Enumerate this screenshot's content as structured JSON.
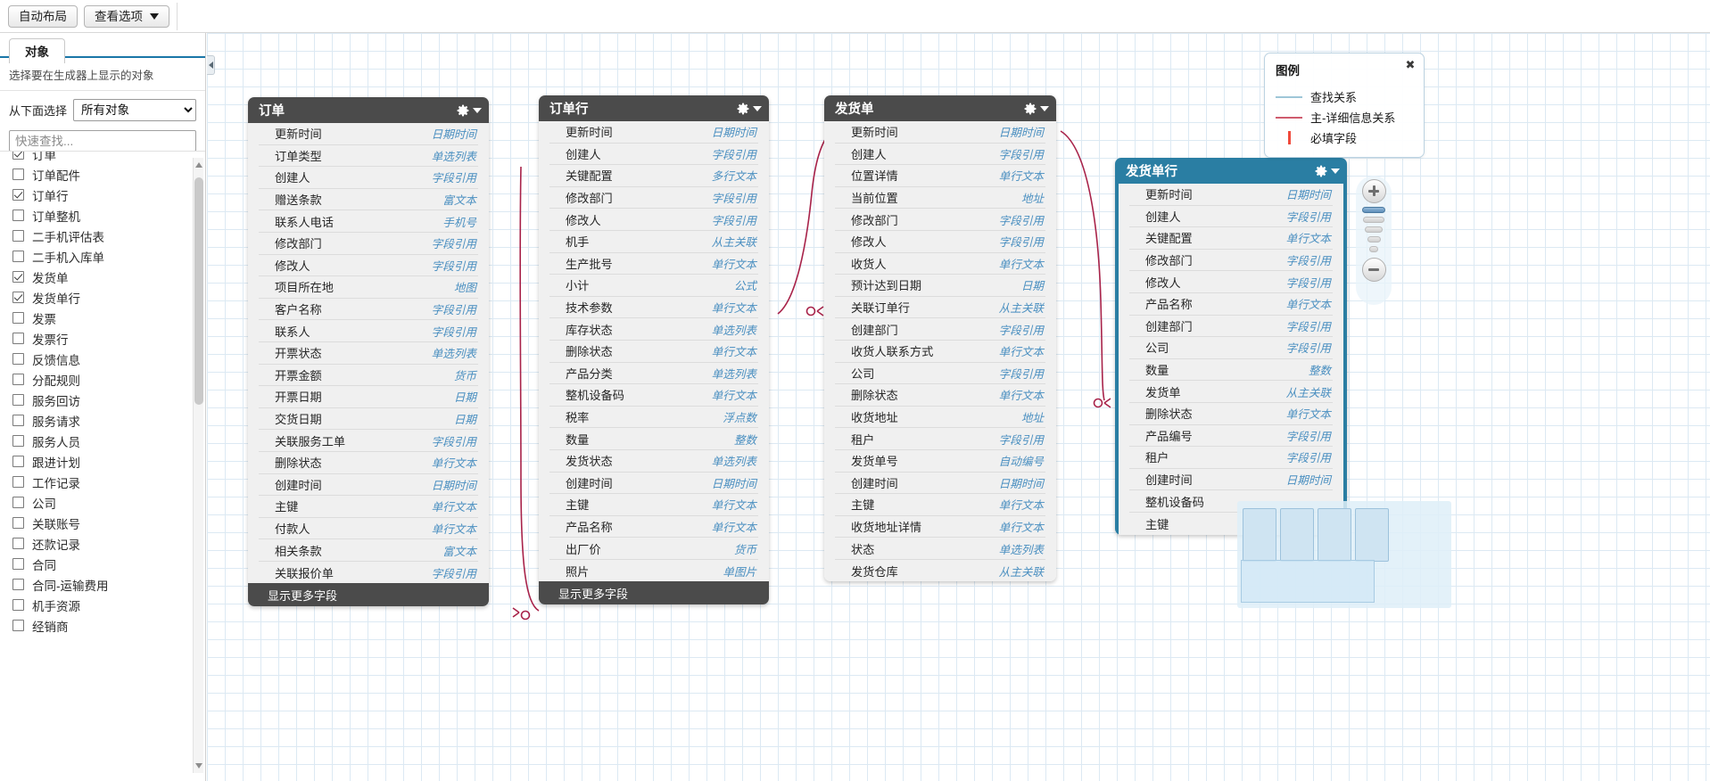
{
  "toolbar": {
    "auto_layout_label": "自动布局",
    "view_options_label": "查看选项"
  },
  "sidebar": {
    "tab_label": "对象",
    "description": "选择要在生成器上显示的对象",
    "select_label": "从下面选择",
    "select_value": "所有对象",
    "search_placeholder": "快速查找...",
    "items": [
      {
        "label": "订单",
        "checked": true
      },
      {
        "label": "订单配件",
        "checked": false
      },
      {
        "label": "订单行",
        "checked": true
      },
      {
        "label": "订单整机",
        "checked": false
      },
      {
        "label": "二手机评估表",
        "checked": false
      },
      {
        "label": "二手机入库单",
        "checked": false
      },
      {
        "label": "发货单",
        "checked": true
      },
      {
        "label": "发货单行",
        "checked": true
      },
      {
        "label": "发票",
        "checked": false
      },
      {
        "label": "发票行",
        "checked": false
      },
      {
        "label": "反馈信息",
        "checked": false
      },
      {
        "label": "分配规则",
        "checked": false
      },
      {
        "label": "服务回访",
        "checked": false
      },
      {
        "label": "服务请求",
        "checked": false
      },
      {
        "label": "服务人员",
        "checked": false
      },
      {
        "label": "跟进计划",
        "checked": false
      },
      {
        "label": "工作记录",
        "checked": false
      },
      {
        "label": "公司",
        "checked": false
      },
      {
        "label": "关联账号",
        "checked": false
      },
      {
        "label": "还款记录",
        "checked": false
      },
      {
        "label": "合同",
        "checked": false
      },
      {
        "label": "合同-运输费用",
        "checked": false
      },
      {
        "label": "机手资源",
        "checked": false
      },
      {
        "label": "经销商",
        "checked": false
      }
    ]
  },
  "legend": {
    "title": "图例",
    "close_glyph": "✖",
    "rows": [
      {
        "label": "查找关系",
        "kind": "line",
        "color": "#9ec6d8"
      },
      {
        "label": "主-详细信息关系",
        "kind": "line",
        "color": "#cf5c6e"
      },
      {
        "label": "必填字段",
        "kind": "bar",
        "color": "#f04a3c"
      }
    ]
  },
  "entities": [
    {
      "name": "订单",
      "theme": "dark",
      "footer_label": "显示更多字段",
      "fields": [
        {
          "name": "更新时间",
          "type": "日期时间"
        },
        {
          "name": "订单类型",
          "type": "单选列表"
        },
        {
          "name": "创建人",
          "type": "字段引用"
        },
        {
          "name": "赠送条款",
          "type": "富文本"
        },
        {
          "name": "联系人电话",
          "type": "手机号"
        },
        {
          "name": "修改部门",
          "type": "字段引用"
        },
        {
          "name": "修改人",
          "type": "字段引用"
        },
        {
          "name": "项目所在地",
          "type": "地图"
        },
        {
          "name": "客户名称",
          "type": "字段引用"
        },
        {
          "name": "联系人",
          "type": "字段引用"
        },
        {
          "name": "开票状态",
          "type": "单选列表"
        },
        {
          "name": "开票金额",
          "type": "货币"
        },
        {
          "name": "开票日期",
          "type": "日期"
        },
        {
          "name": "交货日期",
          "type": "日期"
        },
        {
          "name": "关联服务工单",
          "type": "字段引用"
        },
        {
          "name": "删除状态",
          "type": "单行文本"
        },
        {
          "name": "创建时间",
          "type": "日期时间"
        },
        {
          "name": "主键",
          "type": "单行文本"
        },
        {
          "name": "付款人",
          "type": "单行文本"
        },
        {
          "name": "相关条款",
          "type": "富文本"
        },
        {
          "name": "关联报价单",
          "type": "字段引用"
        }
      ]
    },
    {
      "name": "订单行",
      "theme": "dark",
      "footer_label": "显示更多字段",
      "fields": [
        {
          "name": "更新时间",
          "type": "日期时间"
        },
        {
          "name": "创建人",
          "type": "字段引用"
        },
        {
          "name": "关键配置",
          "type": "多行文本"
        },
        {
          "name": "修改部门",
          "type": "字段引用"
        },
        {
          "name": "修改人",
          "type": "字段引用"
        },
        {
          "name": "机手",
          "type": "从主关联"
        },
        {
          "name": "生产批号",
          "type": "单行文本"
        },
        {
          "name": "小计",
          "type": "公式"
        },
        {
          "name": "技术参数",
          "type": "单行文本"
        },
        {
          "name": "库存状态",
          "type": "单选列表"
        },
        {
          "name": "删除状态",
          "type": "单行文本"
        },
        {
          "name": "产品分类",
          "type": "单选列表"
        },
        {
          "name": "整机设备码",
          "type": "单行文本"
        },
        {
          "name": "税率",
          "type": "浮点数"
        },
        {
          "name": "数量",
          "type": "整数"
        },
        {
          "name": "发货状态",
          "type": "单选列表"
        },
        {
          "name": "创建时间",
          "type": "日期时间"
        },
        {
          "name": "主键",
          "type": "单行文本"
        },
        {
          "name": "产品名称",
          "type": "单行文本"
        },
        {
          "name": "出厂价",
          "type": "货币"
        },
        {
          "name": "照片",
          "type": "单图片"
        }
      ]
    },
    {
      "name": "发货单",
      "theme": "dark",
      "footer_label": "",
      "fields": [
        {
          "name": "更新时间",
          "type": "日期时间"
        },
        {
          "name": "创建人",
          "type": "字段引用"
        },
        {
          "name": "位置详情",
          "type": "单行文本"
        },
        {
          "name": "当前位置",
          "type": "地址"
        },
        {
          "name": "修改部门",
          "type": "字段引用"
        },
        {
          "name": "修改人",
          "type": "字段引用"
        },
        {
          "name": "收货人",
          "type": "单行文本"
        },
        {
          "name": "预计达到日期",
          "type": "日期"
        },
        {
          "name": "关联订单行",
          "type": "从主关联"
        },
        {
          "name": "创建部门",
          "type": "字段引用"
        },
        {
          "name": "收货人联系方式",
          "type": "单行文本"
        },
        {
          "name": "公司",
          "type": "字段引用"
        },
        {
          "name": "删除状态",
          "type": "单行文本"
        },
        {
          "name": "收货地址",
          "type": "地址"
        },
        {
          "name": "租户",
          "type": "字段引用"
        },
        {
          "name": "发货单号",
          "type": "自动编号"
        },
        {
          "name": "创建时间",
          "type": "日期时间"
        },
        {
          "name": "主键",
          "type": "单行文本"
        },
        {
          "name": "收货地址详情",
          "type": "单行文本"
        },
        {
          "name": "状态",
          "type": "单选列表"
        },
        {
          "name": "发货仓库",
          "type": "从主关联"
        }
      ]
    },
    {
      "name": "发货单行",
      "theme": "teal",
      "footer_label": "",
      "fields": [
        {
          "name": "更新时间",
          "type": "日期时间"
        },
        {
          "name": "创建人",
          "type": "字段引用"
        },
        {
          "name": "关键配置",
          "type": "单行文本"
        },
        {
          "name": "修改部门",
          "type": "字段引用"
        },
        {
          "name": "修改人",
          "type": "字段引用"
        },
        {
          "name": "产品名称",
          "type": "单行文本"
        },
        {
          "name": "创建部门",
          "type": "字段引用"
        },
        {
          "name": "公司",
          "type": "字段引用"
        },
        {
          "name": "数量",
          "type": "整数"
        },
        {
          "name": "发货单",
          "type": "从主关联"
        },
        {
          "name": "删除状态",
          "type": "单行文本"
        },
        {
          "name": "产品编号",
          "type": "字段引用"
        },
        {
          "name": "租户",
          "type": "字段引用"
        },
        {
          "name": "创建时间",
          "type": "日期时间"
        },
        {
          "name": "整机设备码",
          "type": ""
        },
        {
          "name": "主键",
          "type": ""
        }
      ]
    }
  ],
  "colors": {
    "accent": "#1a76a8",
    "card_header_dark": "#4b4b4b",
    "card_header_teal": "#2a7ea3",
    "master_detail_link": "#a8234a",
    "lookup_link": "#9ec6d8",
    "field_type_text": "#4a8fc0"
  }
}
